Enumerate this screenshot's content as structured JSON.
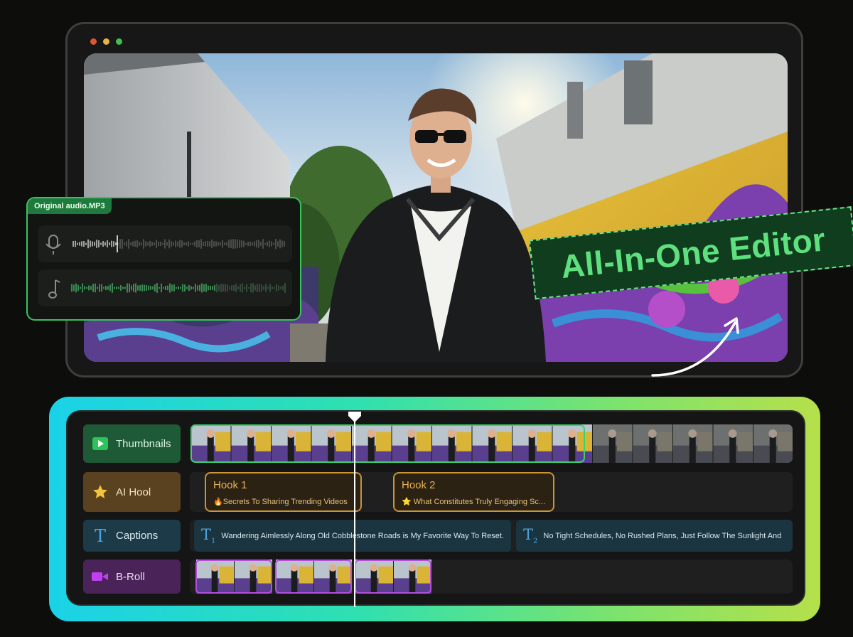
{
  "audio_panel": {
    "file_label": "Original audio.MP3"
  },
  "badge": {
    "text": "All-In-One Editor"
  },
  "tracks": {
    "thumbnails": {
      "label": "Thumbnails"
    },
    "ai_hook": {
      "label": "AI Hool"
    },
    "captions": {
      "label": "Captions"
    },
    "broll": {
      "label": "B-Roll"
    }
  },
  "hooks": [
    {
      "title": "Hook 1",
      "subtitle": "🔥Secrets To Sharing Trending Videos"
    },
    {
      "title": "Hook 2",
      "subtitle": "⭐ What Constitutes Truly Engaging Sc..."
    }
  ],
  "captions": [
    {
      "index": "1",
      "text": "Wandering Aimlessly Along Old Cobblestone Roads is My Favorite Way To Reset."
    },
    {
      "index": "2",
      "text": "No Tight Schedules, No Rushed Plans, Just Follow The Sunlight And"
    }
  ],
  "colors": {
    "thumbnails_label_bg": "#1f5a36",
    "hook_label_bg": "#5a4220",
    "captions_label_bg": "#1d3a48",
    "broll_label_bg": "#4a2459",
    "window_dot_red": "#e4532f",
    "window_dot_yellow": "#e8b43a",
    "window_dot_green": "#3fbf4f"
  },
  "icons": {
    "thumbnails": "play-icon",
    "ai_hook": "star-icon",
    "captions": "text-t-icon",
    "broll": "video-camera-icon",
    "audio_voice": "microphone-icon",
    "audio_music": "music-note-icon"
  }
}
